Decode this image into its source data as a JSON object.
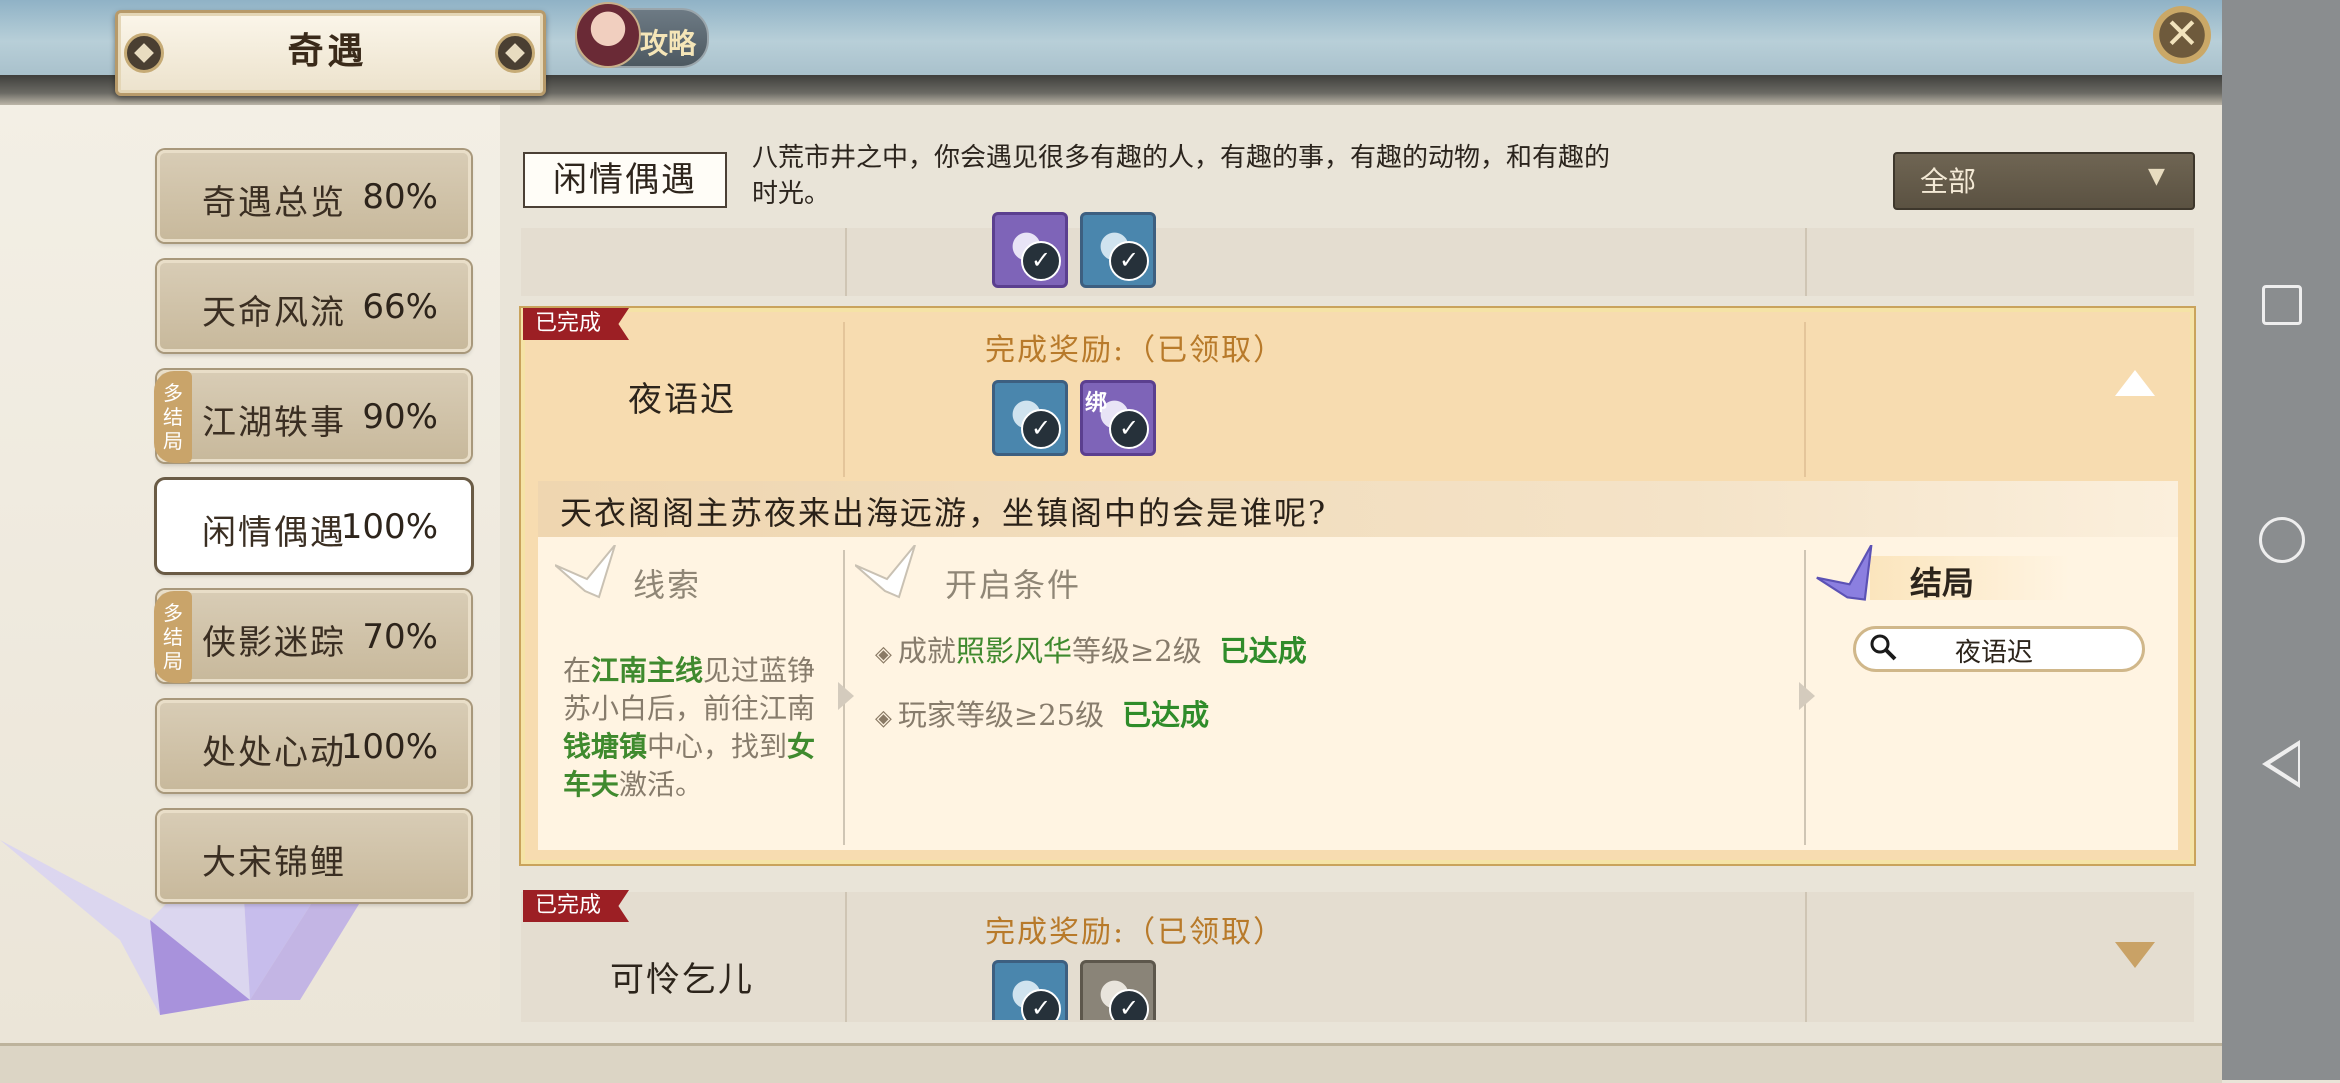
{
  "header": {
    "title": "奇遇",
    "guide_label": "攻略",
    "close_symbol": "✕"
  },
  "sidebar": {
    "tabs": [
      {
        "label": "奇遇总览",
        "pct": "80%",
        "multi": false,
        "active": false
      },
      {
        "label": "天命风流",
        "pct": "66%",
        "multi": false,
        "active": false
      },
      {
        "label": "江湖轶事",
        "pct": "90%",
        "multi": true,
        "active": false
      },
      {
        "label": "闲情偶遇",
        "pct": "100%",
        "multi": false,
        "active": true
      },
      {
        "label": "侠影迷踪",
        "pct": "70%",
        "multi": true,
        "active": false
      },
      {
        "label": "处处心动",
        "pct": "100%",
        "multi": false,
        "active": false
      },
      {
        "label": "大宋锦鲤",
        "pct": "",
        "multi": false,
        "active": false
      }
    ],
    "multi_badge": "多结局"
  },
  "category": {
    "label": "闲情偶遇",
    "description": "八荒市井之中，你会遇见很多有趣的人，有趣的事，有趣的动物，和有趣的时光。"
  },
  "filter": {
    "selected": "全部"
  },
  "quests": [
    {
      "status": "已完成",
      "name": "夜语迟",
      "reward_title": "完成奖励:（已领取）",
      "expanded": true,
      "question": "天衣阁阁主苏夜来出海远游，坐镇阁中的会是谁呢?",
      "clue_title": "线索",
      "clue_parts": [
        "在",
        "江南主线",
        "见过蓝铮苏小白后，前往江南",
        "钱塘镇",
        "中心，找到",
        "女车夫",
        "激活。"
      ],
      "conditions_title": "开启条件",
      "conditions": [
        {
          "prefix": "成就",
          "highlight": "照影风华",
          "suffix": "等级≥2级",
          "status": "已达成"
        },
        {
          "prefix": "玩家等级≥25级",
          "highlight": "",
          "suffix": "",
          "status": "已达成"
        }
      ],
      "ending_title": "结局",
      "ending_name": "夜语迟",
      "reward_bind_label": "绑"
    },
    {
      "status": "已完成",
      "name": "可怜乞儿",
      "reward_title": "完成奖励:（已领取）",
      "expanded": false
    }
  ],
  "icons": {
    "close": "close-icon",
    "search": "search-icon",
    "check": "check-icon",
    "crane": "paper-crane-icon"
  },
  "colors": {
    "accent_gold": "#b87a2a",
    "done_red": "#9c1f24",
    "achieved_green": "#2f8c2a",
    "highlight_green": "#3f8a2e"
  }
}
